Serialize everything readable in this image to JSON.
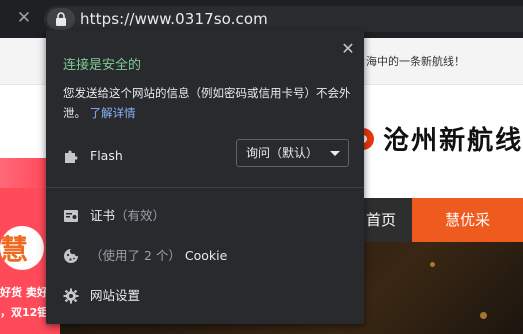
{
  "browser": {
    "url": "https://www.0317so.com",
    "close_glyph": "✕"
  },
  "page": {
    "notice": "海中的一条新航线！",
    "brand_name": "沧州新航线",
    "nav": {
      "home": "首页",
      "hot": "慧优采"
    },
    "promo": {
      "circle_char": "慧",
      "line1": "好货 卖好",
      "line2": "，双12钜"
    }
  },
  "popup": {
    "close_glyph": "✕",
    "secure_title": "连接是安全的",
    "secure_desc": "您发送给这个网站的信息（例如密码或信用卡号）不会外泄。",
    "learn_more": "了解详情",
    "flash": {
      "label": "Flash",
      "select_value": "询问（默认）"
    },
    "certificate": {
      "label": "证书",
      "status": "（有效）"
    },
    "cookie": {
      "prefix": "（使用了 2 个）",
      "label": "Cookie"
    },
    "site_settings": {
      "label": "网站设置"
    }
  },
  "colors": {
    "popup_bg": "#292a2d",
    "secure_green": "#81c995",
    "link_blue": "#8ab4f8",
    "accent_orange": "#ef5a1e"
  },
  "icons": {
    "lock": "lock-icon",
    "puzzle": "puzzle-icon",
    "certificate": "certificate-icon",
    "cookie": "cookie-icon",
    "gear": "gear-icon"
  }
}
